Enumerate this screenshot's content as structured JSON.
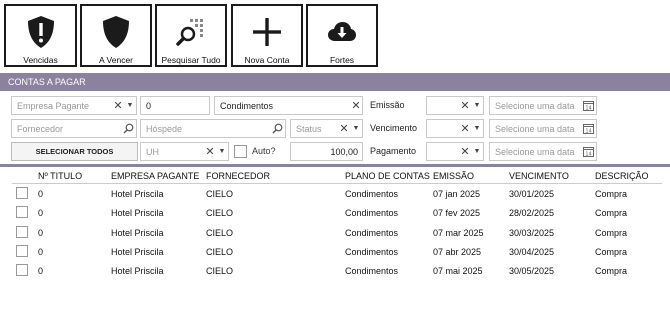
{
  "toolbar": {
    "buttons": [
      {
        "label": "Vencidas",
        "icon": "shield-exclamation-icon"
      },
      {
        "label": "A Vencer",
        "icon": "shield-icon"
      },
      {
        "label": "Pesquisar Tudo",
        "icon": "search-grid-icon"
      },
      {
        "label": "Nova Conta",
        "icon": "plus-icon"
      },
      {
        "label": "Fortes",
        "icon": "cloud-download-icon"
      }
    ]
  },
  "section": {
    "title": "CONTAS A PAGAR"
  },
  "filters": {
    "empresa_pagante": {
      "placeholder": "Empresa Pagante"
    },
    "zero_field": {
      "value": "0"
    },
    "plano": {
      "value": "Condimentos"
    },
    "emissao_label": "Emissão",
    "fornecedor": {
      "placeholder": "Fornecedor"
    },
    "hospede": {
      "placeholder": "Hóspede"
    },
    "status": {
      "placeholder": "Status"
    },
    "vencimento_label": "Vencimento",
    "select_all_label": "SELECIONAR TODOS",
    "uh": {
      "placeholder": "UH"
    },
    "auto_label": "Auto?",
    "valor": {
      "value": "100,00"
    },
    "pagamento_label": "Pagamento",
    "date_placeholder": "Selecione uma data"
  },
  "table": {
    "columns": [
      "Nº TITULO",
      "EMPRESA PAGANTE",
      "FORNECEDOR",
      "PLANO DE CONTAS",
      "EMISSÃO",
      "VENCIMENTO",
      "DESCRIÇÃO"
    ],
    "rows": [
      [
        "0",
        "Hotel Priscila",
        "CIELO",
        "Condimentos",
        "07 jan 2025",
        "30/01/2025",
        "Compra"
      ],
      [
        "0",
        "Hotel Priscila",
        "CIELO",
        "Condimentos",
        "07 fev 2025",
        "28/02/2025",
        "Compra"
      ],
      [
        "0",
        "Hotel Priscila",
        "CIELO",
        "Condimentos",
        "07 mar 2025",
        "30/03/2025",
        "Compra"
      ],
      [
        "0",
        "Hotel Priscila",
        "CIELO",
        "Condimentos",
        "07 abr 2025",
        "30/04/2025",
        "Compra"
      ],
      [
        "0",
        "Hotel Priscila",
        "CIELO",
        "Condimentos",
        "07 mai 2025",
        "30/05/2025",
        "Compra"
      ]
    ]
  },
  "colors": {
    "header_bar": "#8c819e",
    "icon": "#1b1b1b"
  }
}
